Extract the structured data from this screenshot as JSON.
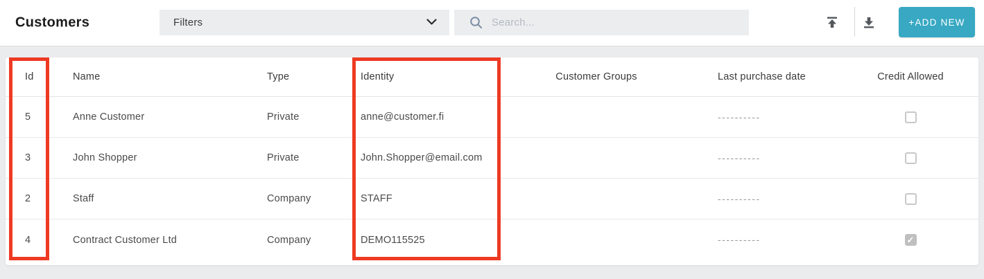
{
  "header": {
    "title": "Customers",
    "filters": {
      "label": "Filters"
    },
    "search": {
      "placeholder": "Search..."
    },
    "actions": {
      "add_new_label": "+ADD NEW"
    },
    "icons": {
      "filters_chevron": "chevron-down-icon",
      "search": "search-icon",
      "upload": "upload-icon",
      "download": "download-icon"
    }
  },
  "table": {
    "columns": [
      "Id",
      "Name",
      "Type",
      "Identity",
      "Customer Groups",
      "Last purchase date",
      "Credit Allowed"
    ],
    "rows": [
      {
        "id": "5",
        "name": "Anne Customer",
        "type": "Private",
        "identity": "anne@customer.fi",
        "customer_groups": "",
        "last_purchase_date": "----------",
        "credit_allowed": false
      },
      {
        "id": "3",
        "name": "John Shopper",
        "type": "Private",
        "identity": "John.Shopper@email.com",
        "customer_groups": "",
        "last_purchase_date": "----------",
        "credit_allowed": false
      },
      {
        "id": "2",
        "name": "Staff",
        "type": "Company",
        "identity": "STAFF",
        "customer_groups": "",
        "last_purchase_date": "----------",
        "credit_allowed": false
      },
      {
        "id": "4",
        "name": "Contract Customer Ltd",
        "type": "Company",
        "identity": "DEMO115525",
        "customer_groups": "",
        "last_purchase_date": "----------",
        "credit_allowed": true
      }
    ]
  },
  "highlights": {
    "color": "#ee3a23",
    "boxed_columns": [
      "Id",
      "Identity"
    ]
  },
  "colors": {
    "accent": "#38a8c3",
    "highlight_red": "#ee3a23"
  }
}
